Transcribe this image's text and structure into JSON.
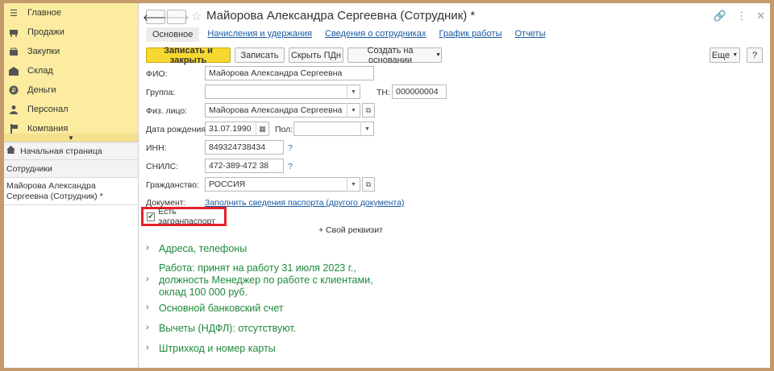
{
  "sidebar": {
    "nav_items": [
      {
        "label": "Главное",
        "icon": "menu-icon"
      },
      {
        "label": "Продажи",
        "icon": "cart-icon"
      },
      {
        "label": "Закупки",
        "icon": "purchase-icon"
      },
      {
        "label": "Склад",
        "icon": "warehouse-icon"
      },
      {
        "label": "Деньги",
        "icon": "money-icon"
      },
      {
        "label": "Персонал",
        "icon": "personnel-icon"
      },
      {
        "label": "Компания",
        "icon": "company-icon"
      }
    ],
    "open_windows": {
      "home": "Начальная страница",
      "employees": "Сотрудники",
      "current": "Майорова Александра Сергеевна (Сотрудник) *"
    }
  },
  "header": {
    "title": "Майорова Александра Сергеевна (Сотрудник) *"
  },
  "tabs": [
    "Основное",
    "Начисления и удержания",
    "Сведения о сотрудниках",
    "График работы",
    "Отчеты"
  ],
  "toolbar": {
    "save_close": "Записать и закрыть",
    "save": "Записать",
    "hide_pd": "Скрыть ПДн",
    "create_based": "Создать на основании",
    "more": "Еще",
    "help": "?"
  },
  "form": {
    "fio_label": "ФИО:",
    "fio_value": "Майорова Александра Сергеевна",
    "group_label": "Группа:",
    "group_value": "",
    "tn_label": "ТН:",
    "tn_value": "000000004",
    "person_label": "Физ. лицо:",
    "person_value": "Майорова Александра Сергеевна",
    "birth_label": "Дата рождения:",
    "birth_value": "31.07.1990",
    "gender_label": "Пол:",
    "gender_value": "",
    "inn_label": "ИНН:",
    "inn_value": "849324738434",
    "snils_label": "СНИЛС:",
    "snils_value": "472-389-472 38",
    "citizenship_label": "Гражданство:",
    "citizenship_value": "РОССИЯ",
    "document_label": "Документ:",
    "document_link": "Заполнить сведения паспорта (другого документа)",
    "passport_checkbox": "Есть загранпаспорт",
    "passport_checked": true,
    "custom_attr": "+ Свой реквизит",
    "help_mark": "?"
  },
  "sections": [
    "Адреса, телефоны",
    "Работа: принят на работу 31 июля 2023 г., должность Менеджер по работе с клиентами, оклад 100 000 руб.",
    "Основной банковский счет",
    "Вычеты (НДФЛ): отсутствуют.",
    "Штрихкод и номер карты"
  ],
  "colors": {
    "nav_bg": "#fbeca0",
    "primary_button": "#f7d830",
    "section_text": "#1e8a3c",
    "highlight_border": "#e5202a",
    "link": "#1a5aa0"
  }
}
